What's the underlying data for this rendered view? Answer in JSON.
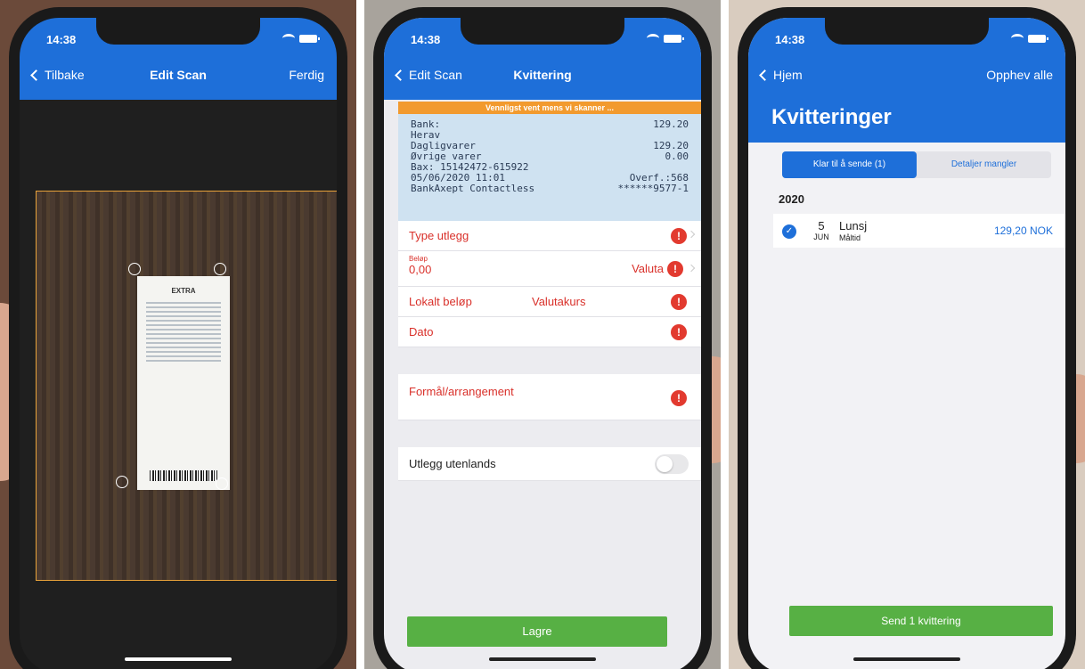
{
  "status": {
    "time": "14:38"
  },
  "panel1": {
    "nav": {
      "back_label": "Tilbake",
      "title": "Edit Scan",
      "done_label": "Ferdig"
    },
    "receipt_brand": "EXTRA"
  },
  "panel2": {
    "nav": {
      "back_label": "Edit Scan",
      "title": "Kvittering"
    },
    "banner": "Vennligst vent mens vi skanner ...",
    "scan_lines": [
      {
        "left": "Bank:",
        "right": "129.20"
      },
      {
        "left": "",
        "right": ""
      },
      {
        "left": "Herav",
        "right": ""
      },
      {
        "left": "Dagligvarer",
        "right": "129.20"
      },
      {
        "left": "Øvrige varer",
        "right": "0.00"
      },
      {
        "left": "Bax: 15142472-615922",
        "right": ""
      },
      {
        "left": "05/06/2020 11:01",
        "right": "Overf.:568"
      },
      {
        "left": "BankAxept Contactless",
        "right": "******9577-1"
      }
    ],
    "form": {
      "type_label": "Type utlegg",
      "amount_label": "Beløp",
      "amount_value": "0,00",
      "currency_label": "Valuta",
      "local_amount_label": "Lokalt beløp",
      "rate_label": "Valutakurs",
      "date_label": "Dato",
      "purpose_label": "Formål/arrangement",
      "abroad_label": "Utlegg utenlands",
      "alert_glyph": "!"
    },
    "save_label": "Lagre"
  },
  "panel3": {
    "nav": {
      "back_label": "Hjem",
      "right_label": "Opphev alle"
    },
    "title": "Kvitteringer",
    "tabs": {
      "ready": "Klar til å sende (1)",
      "missing": "Detaljer mangler"
    },
    "year": "2020",
    "receipt": {
      "day": "5",
      "month": "JUN",
      "name": "Lunsj",
      "category": "Måltid",
      "amount": "129,20 NOK"
    },
    "send_label": "Send 1 kvittering"
  },
  "colors": {
    "brand_blue": "#1e6fd9",
    "action_green": "#57b044",
    "alert_red": "#e23a2f",
    "scan_orange": "#f29a2e"
  }
}
